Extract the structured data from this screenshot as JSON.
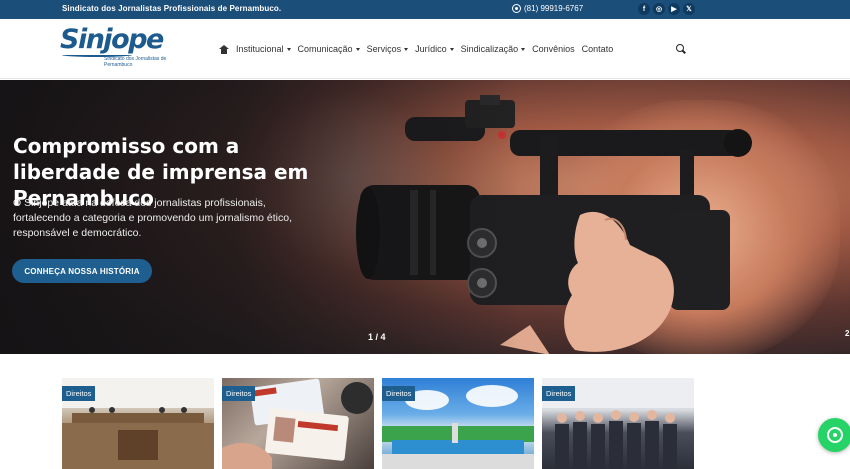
{
  "topbar": {
    "org_name": "Sindicato dos Jornalistas Profissionais de Pernambuco.",
    "phone": "(81) 99919-6767",
    "socials": [
      {
        "icon": "facebook-icon",
        "glyph": "f"
      },
      {
        "icon": "instagram-icon",
        "glyph": "◎"
      },
      {
        "icon": "youtube-icon",
        "glyph": "▶"
      },
      {
        "icon": "x-twitter-icon",
        "glyph": "𝕏"
      }
    ]
  },
  "logo": {
    "mark": "Sinjope",
    "tagline": "Sindicato dos Jornalistas de Pernambuco"
  },
  "nav": {
    "items": [
      {
        "label": "Institucional",
        "dropdown": true
      },
      {
        "label": "Comunicação",
        "dropdown": true
      },
      {
        "label": "Serviços",
        "dropdown": true
      },
      {
        "label": "Jurídico",
        "dropdown": true
      },
      {
        "label": "Sindicalização",
        "dropdown": true
      },
      {
        "label": "Convênios",
        "dropdown": false
      },
      {
        "label": "Contato",
        "dropdown": false
      }
    ]
  },
  "hero": {
    "title": "Compromisso com a liberdade de imprensa em Pernambuco",
    "description": "O Sinjope atua na defesa dos jornalistas profissionais, fortalecendo a categoria e promovendo um jornalismo ético, responsável e democrático.",
    "cta_label": "CONHEÇA NOSSA HISTÓRIA",
    "pager": "1 / 4",
    "next_pager": "2"
  },
  "cards": [
    {
      "tag": "Direitos"
    },
    {
      "tag": "Direitos"
    },
    {
      "tag": "Direitos"
    },
    {
      "tag": "Direitos"
    }
  ],
  "colors": {
    "brand_blue": "#1c4e7a",
    "cta_blue": "#1f5f8f",
    "whatsapp_green": "#25d366"
  }
}
